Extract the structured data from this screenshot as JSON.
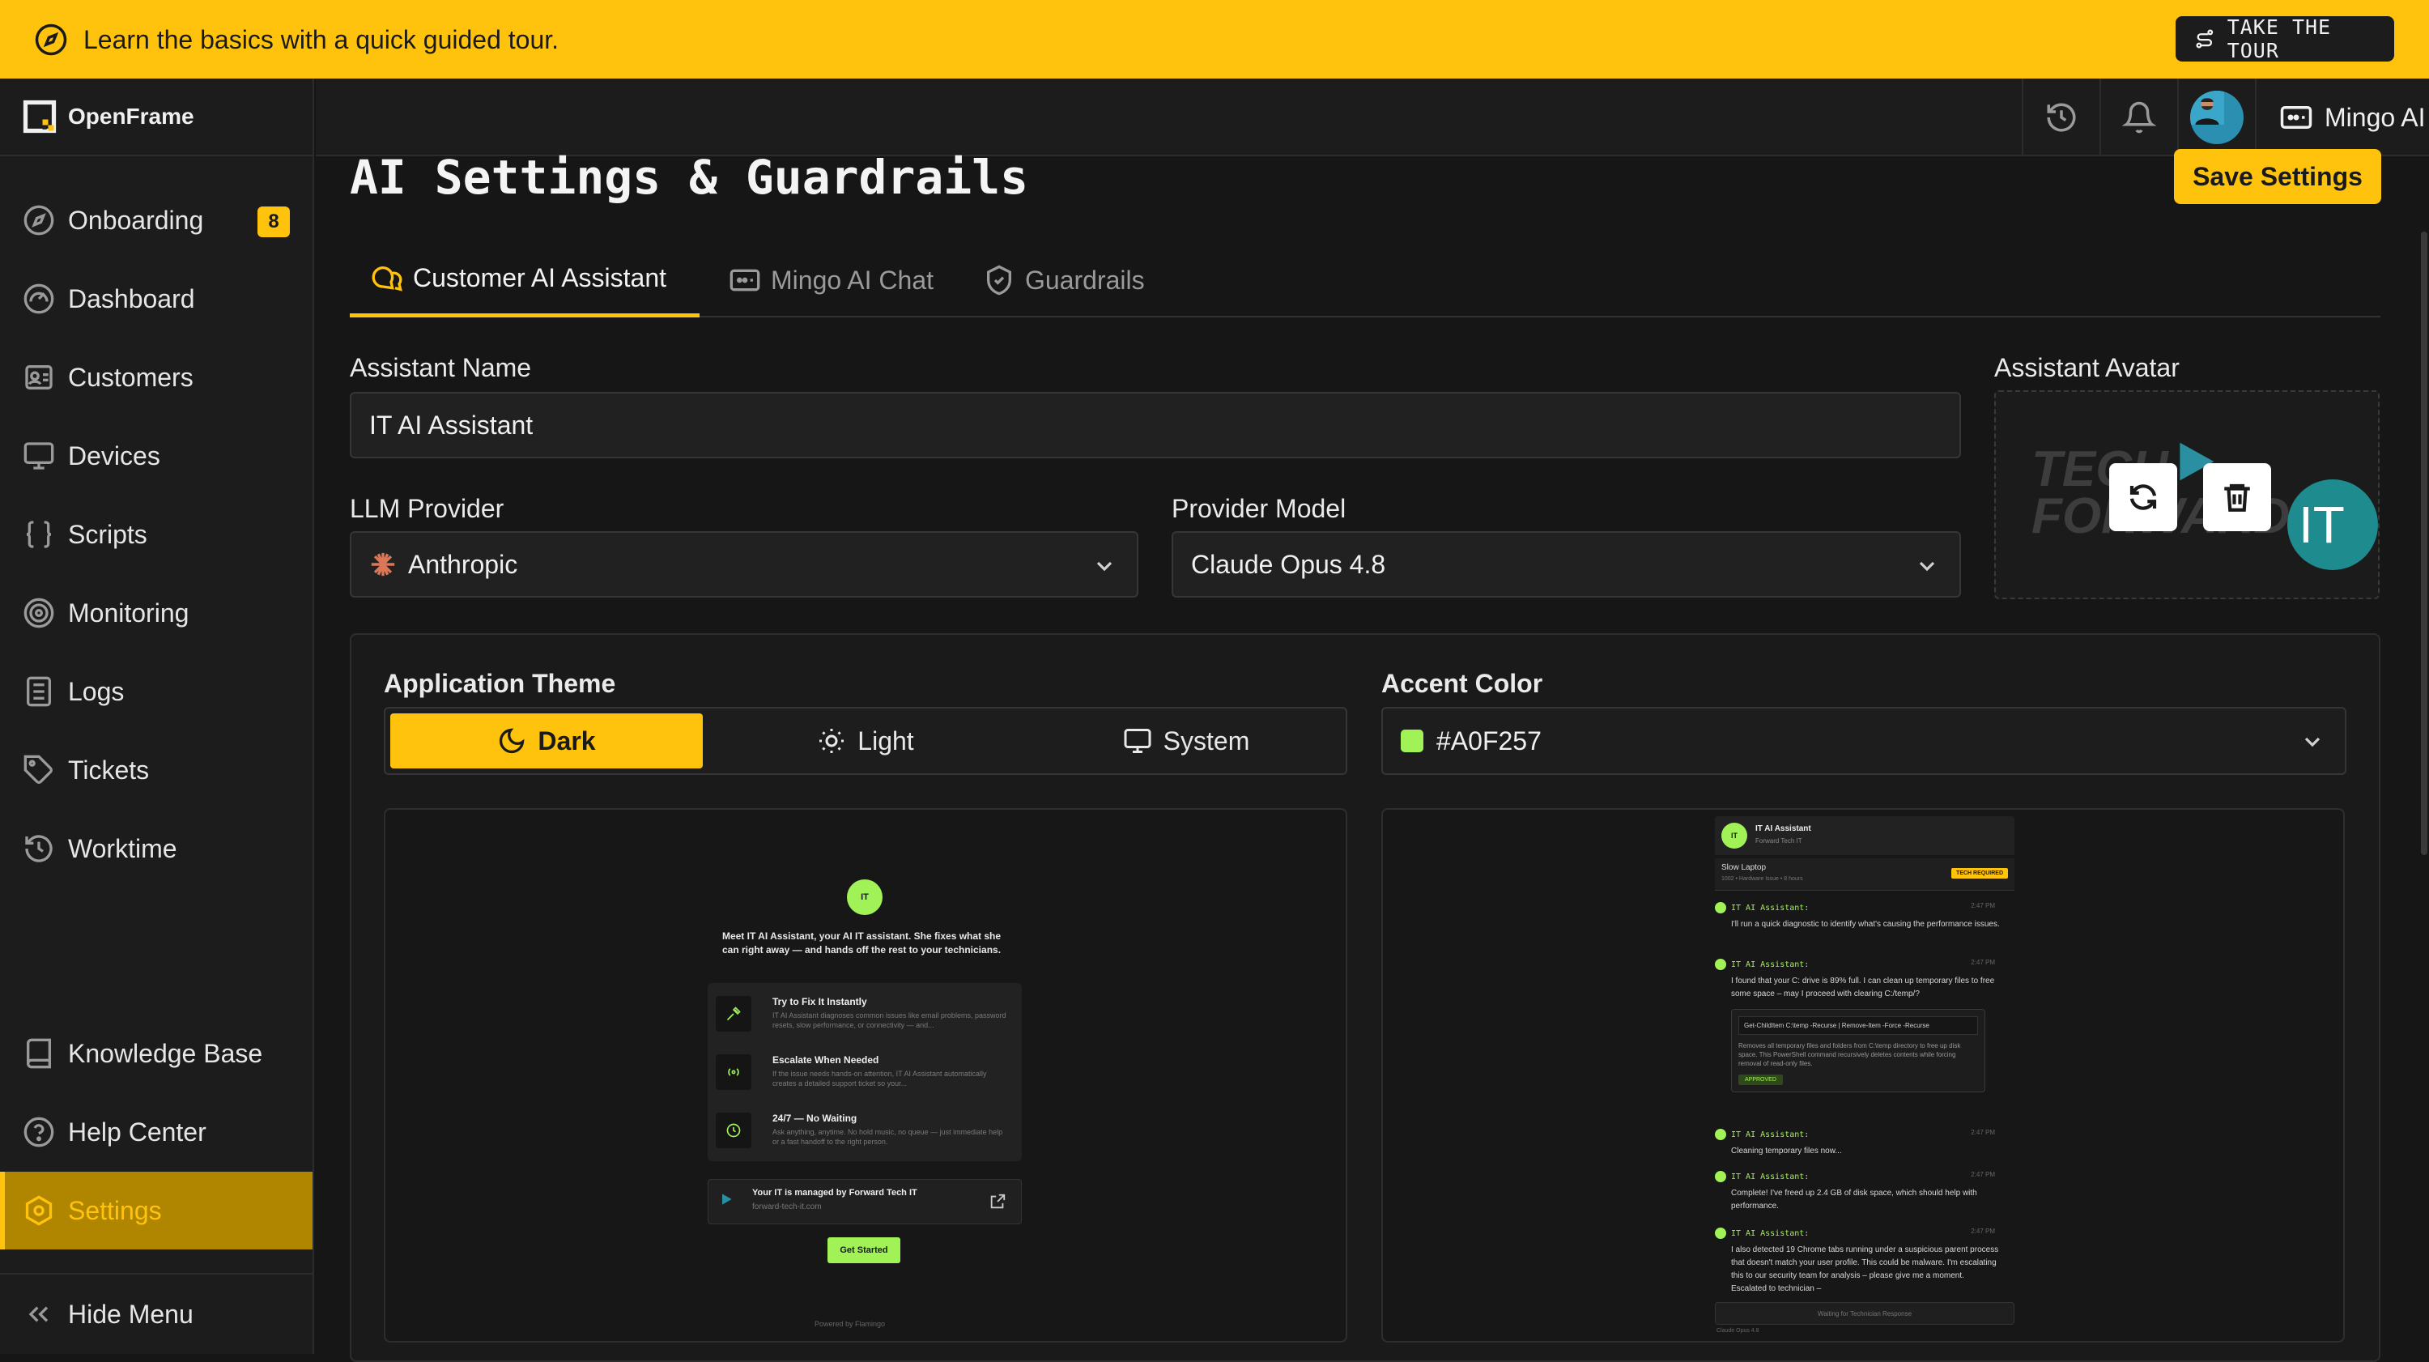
{
  "banner": {
    "text": "Learn the basics with a quick guided tour.",
    "tour_label": "TAKE THE TOUR"
  },
  "app": {
    "name": "OpenFrame"
  },
  "sidebar": {
    "items": [
      {
        "label": "Onboarding",
        "icon": "compass-icon",
        "badge": "8"
      },
      {
        "label": "Dashboard",
        "icon": "gauge-icon"
      },
      {
        "label": "Customers",
        "icon": "id-card-icon"
      },
      {
        "label": "Devices",
        "icon": "monitor-icon"
      },
      {
        "label": "Scripts",
        "icon": "braces-icon"
      },
      {
        "label": "Monitoring",
        "icon": "target-icon"
      },
      {
        "label": "Logs",
        "icon": "list-icon"
      },
      {
        "label": "Tickets",
        "icon": "tag-icon"
      },
      {
        "label": "Worktime",
        "icon": "clock-icon"
      },
      {
        "label": "Knowledge Base",
        "icon": "book-icon"
      },
      {
        "label": "Help Center",
        "icon": "help-icon"
      },
      {
        "label": "Settings",
        "icon": "gear-icon",
        "active": true
      }
    ],
    "hide_menu": "Hide Menu"
  },
  "header": {
    "user_label": "Mingo AI"
  },
  "page": {
    "title": "AI Settings & Guardrails",
    "save_label": "Save Settings"
  },
  "tabs": [
    {
      "label": "Customer AI Assistant",
      "active": true
    },
    {
      "label": "Mingo AI Chat"
    },
    {
      "label": "Guardrails"
    }
  ],
  "form": {
    "assistant_name_label": "Assistant Name",
    "assistant_name_value": "IT AI Assistant",
    "avatar_label": "Assistant Avatar",
    "avatar_initials": "IT",
    "llm_provider_label": "LLM Provider",
    "llm_provider_value": "Anthropic",
    "provider_model_label": "Provider Model",
    "provider_model_value": "Claude Opus 4.8",
    "theme_label": "Application Theme",
    "theme_options": [
      "Dark",
      "Light",
      "System"
    ],
    "accent_label": "Accent Color",
    "accent_value": "#A0F257"
  },
  "colors": {
    "accent": "#ffc30d",
    "assistant_accent": "#a0f257",
    "background": "#161616"
  },
  "preview_left": {
    "intro": "Meet IT AI Assistant, your AI IT assistant. She fixes what she can right away — and hands off the rest to your technicians.",
    "features": [
      {
        "title": "Try to Fix It Instantly",
        "text": "IT AI Assistant diagnoses common issues like email problems, password resets, slow performance, or connectivity — and..."
      },
      {
        "title": "Escalate When Needed",
        "text": "If the issue needs hands-on attention, IT AI Assistant automatically creates a detailed support ticket so your..."
      },
      {
        "title": "24/7 — No Waiting",
        "text": "Ask anything, anytime. No hold music, no queue — just immediate help or a fast handoff to the right person."
      }
    ],
    "managed_title": "Your IT is managed by Forward Tech IT",
    "managed_url": "forward-tech-it.com",
    "cta": "Get Started",
    "powered": "Powered by  Flamingo"
  },
  "preview_right": {
    "chat_title": "IT AI Assistant",
    "chat_sub": "Forward Tech IT",
    "ticket_title": "Slow Laptop",
    "ticket_meta": "1002 • Hardware Issue • 8 hours",
    "ticket_badge": "TECH REQUIRED",
    "messages": [
      {
        "author": "IT AI Assistant:",
        "time": "2:47 PM",
        "text": "I'll run a quick diagnostic to identify what's causing the performance issues."
      },
      {
        "author": "IT AI Assistant:",
        "time": "2:47 PM",
        "text": "I found that your C: drive is 89% full. I can clean up temporary files to free some space – may I proceed with clearing C:/temp/?"
      },
      {
        "author": "IT AI Assistant:",
        "time": "2:47 PM",
        "text": "Cleaning temporary files now..."
      },
      {
        "author": "IT AI Assistant:",
        "time": "2:47 PM",
        "text": "Complete! I've freed up 2.4 GB of disk space, which should help with performance."
      },
      {
        "author": "IT AI Assistant:",
        "time": "2:47 PM",
        "text": "I also detected 19 Chrome tabs running under a suspicious parent process that doesn't match your user profile. This could be malware. I'm escalating this to our security team for analysis – please give me a moment. Escalated to technician –"
      }
    ],
    "code_cmd": "Get-ChildItem C:\\temp -Recurse | Remove-Item -Force -Recurse",
    "code_desc": "Removes all temporary files and folders from C:\\temp directory to free up disk space. This PowerShell command recursively deletes contents while forcing removal of read-only files.",
    "code_status": "APPROVED",
    "waiting": "Waiting for Technician Response",
    "model_footer": "Claude Opus 4.8"
  }
}
